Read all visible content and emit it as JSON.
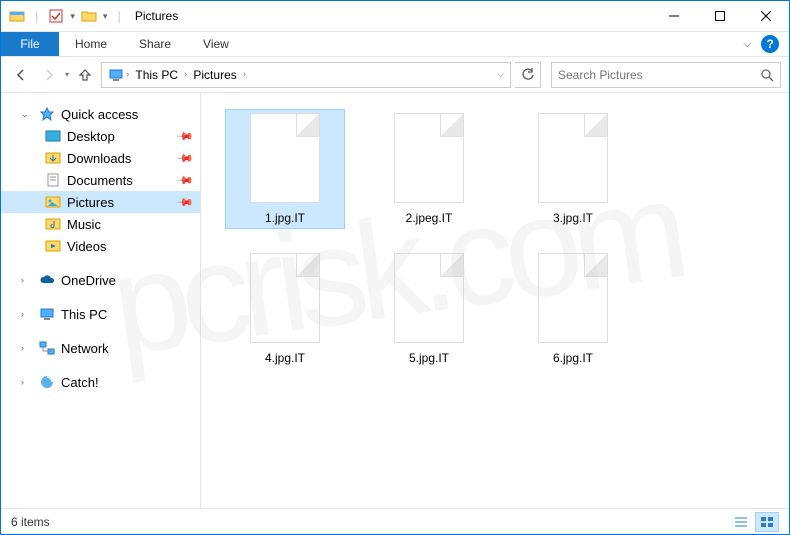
{
  "title": "Pictures",
  "ribbon": {
    "file": "File",
    "tabs": [
      "Home",
      "Share",
      "View"
    ]
  },
  "breadcrumb": {
    "parts": [
      "This PC",
      "Pictures"
    ]
  },
  "search": {
    "placeholder": "Search Pictures"
  },
  "sidebar": {
    "quick_access": "Quick access",
    "quick_items": [
      {
        "label": "Desktop",
        "pinned": true
      },
      {
        "label": "Downloads",
        "pinned": true
      },
      {
        "label": "Documents",
        "pinned": true
      },
      {
        "label": "Pictures",
        "pinned": true,
        "selected": true
      },
      {
        "label": "Music",
        "pinned": false
      },
      {
        "label": "Videos",
        "pinned": false
      }
    ],
    "roots": [
      "OneDrive",
      "This PC",
      "Network",
      "Catch!"
    ]
  },
  "files": [
    {
      "name": "1.jpg.IT",
      "selected": true
    },
    {
      "name": "2.jpeg.IT",
      "selected": false
    },
    {
      "name": "3.jpg.IT",
      "selected": false
    },
    {
      "name": "4.jpg.IT",
      "selected": false
    },
    {
      "name": "5.jpg.IT",
      "selected": false
    },
    {
      "name": "6.jpg.IT",
      "selected": false
    }
  ],
  "status": {
    "count": "6 items"
  },
  "watermark": "pcrisk.com"
}
